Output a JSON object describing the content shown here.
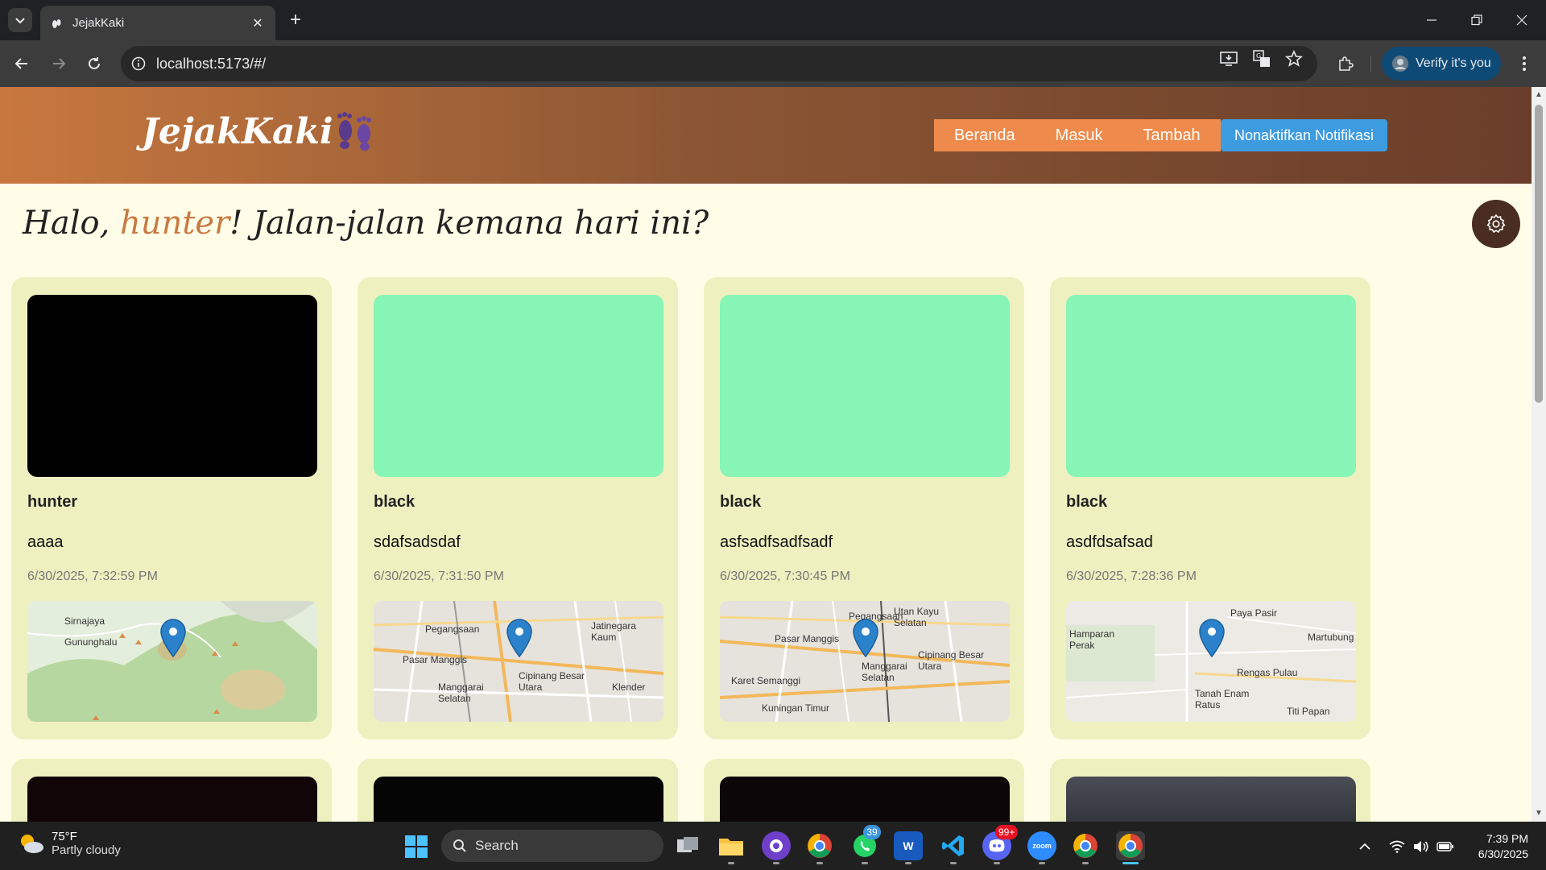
{
  "browser": {
    "tab_title": "JejakKaki",
    "url": "localhost:5173/#/",
    "verify_label": "Verify it's you"
  },
  "app": {
    "logo": "JejakKaki",
    "nav": [
      "Beranda",
      "Masuk",
      "Tambah"
    ],
    "notif_button": "Nonaktifkan Notifikasi",
    "greeting_prefix": "Halo, ",
    "username": "hunter",
    "greeting_suffix": "! Jalan-jalan kemana hari ini?"
  },
  "stories": [
    {
      "name": "hunter",
      "description": "aaaa",
      "date": "6/30/2025, 7:32:59 PM",
      "image_color": "#000000",
      "map_labels": [
        "Sirnajaya",
        "Gununghalu"
      ]
    },
    {
      "name": "black",
      "description": "sdafsadsdaf",
      "date": "6/30/2025, 7:31:50 PM",
      "image_color": "#86f5b5",
      "map_labels": [
        "Pegangsaan",
        "Jatinegara Kaum",
        "Pasar Manggis",
        "Manggarai Selatan",
        "Cipinang Besar Utara",
        "Klender"
      ]
    },
    {
      "name": "black",
      "description": "asfsadfsadfsadf",
      "date": "6/30/2025, 7:30:45 PM",
      "image_color": "#86f5b5",
      "map_labels": [
        "Pegangsaan",
        "Utan Kayu Selatan",
        "Pasar Manggis",
        "Manggarai Selatan",
        "Cipinang Besar Utara",
        "Karet Semanggi",
        "Kuningan Timur"
      ]
    },
    {
      "name": "black",
      "description": "asdfdsafsad",
      "date": "6/30/2025, 7:28:36 PM",
      "image_color": "#86f5b5",
      "map_labels": [
        "Hamparan Perak",
        "Paya Pasir",
        "Martubung",
        "Rengas Pulau",
        "Tanah Enam Ratus",
        "Titi Papan"
      ]
    }
  ],
  "taskbar": {
    "temperature": "75°F",
    "weather": "Partly cloudy",
    "search_placeholder": "Search",
    "whatsapp_badge": "39",
    "discord_badge": "99+",
    "time": "7:39 PM",
    "date": "6/30/2025"
  }
}
